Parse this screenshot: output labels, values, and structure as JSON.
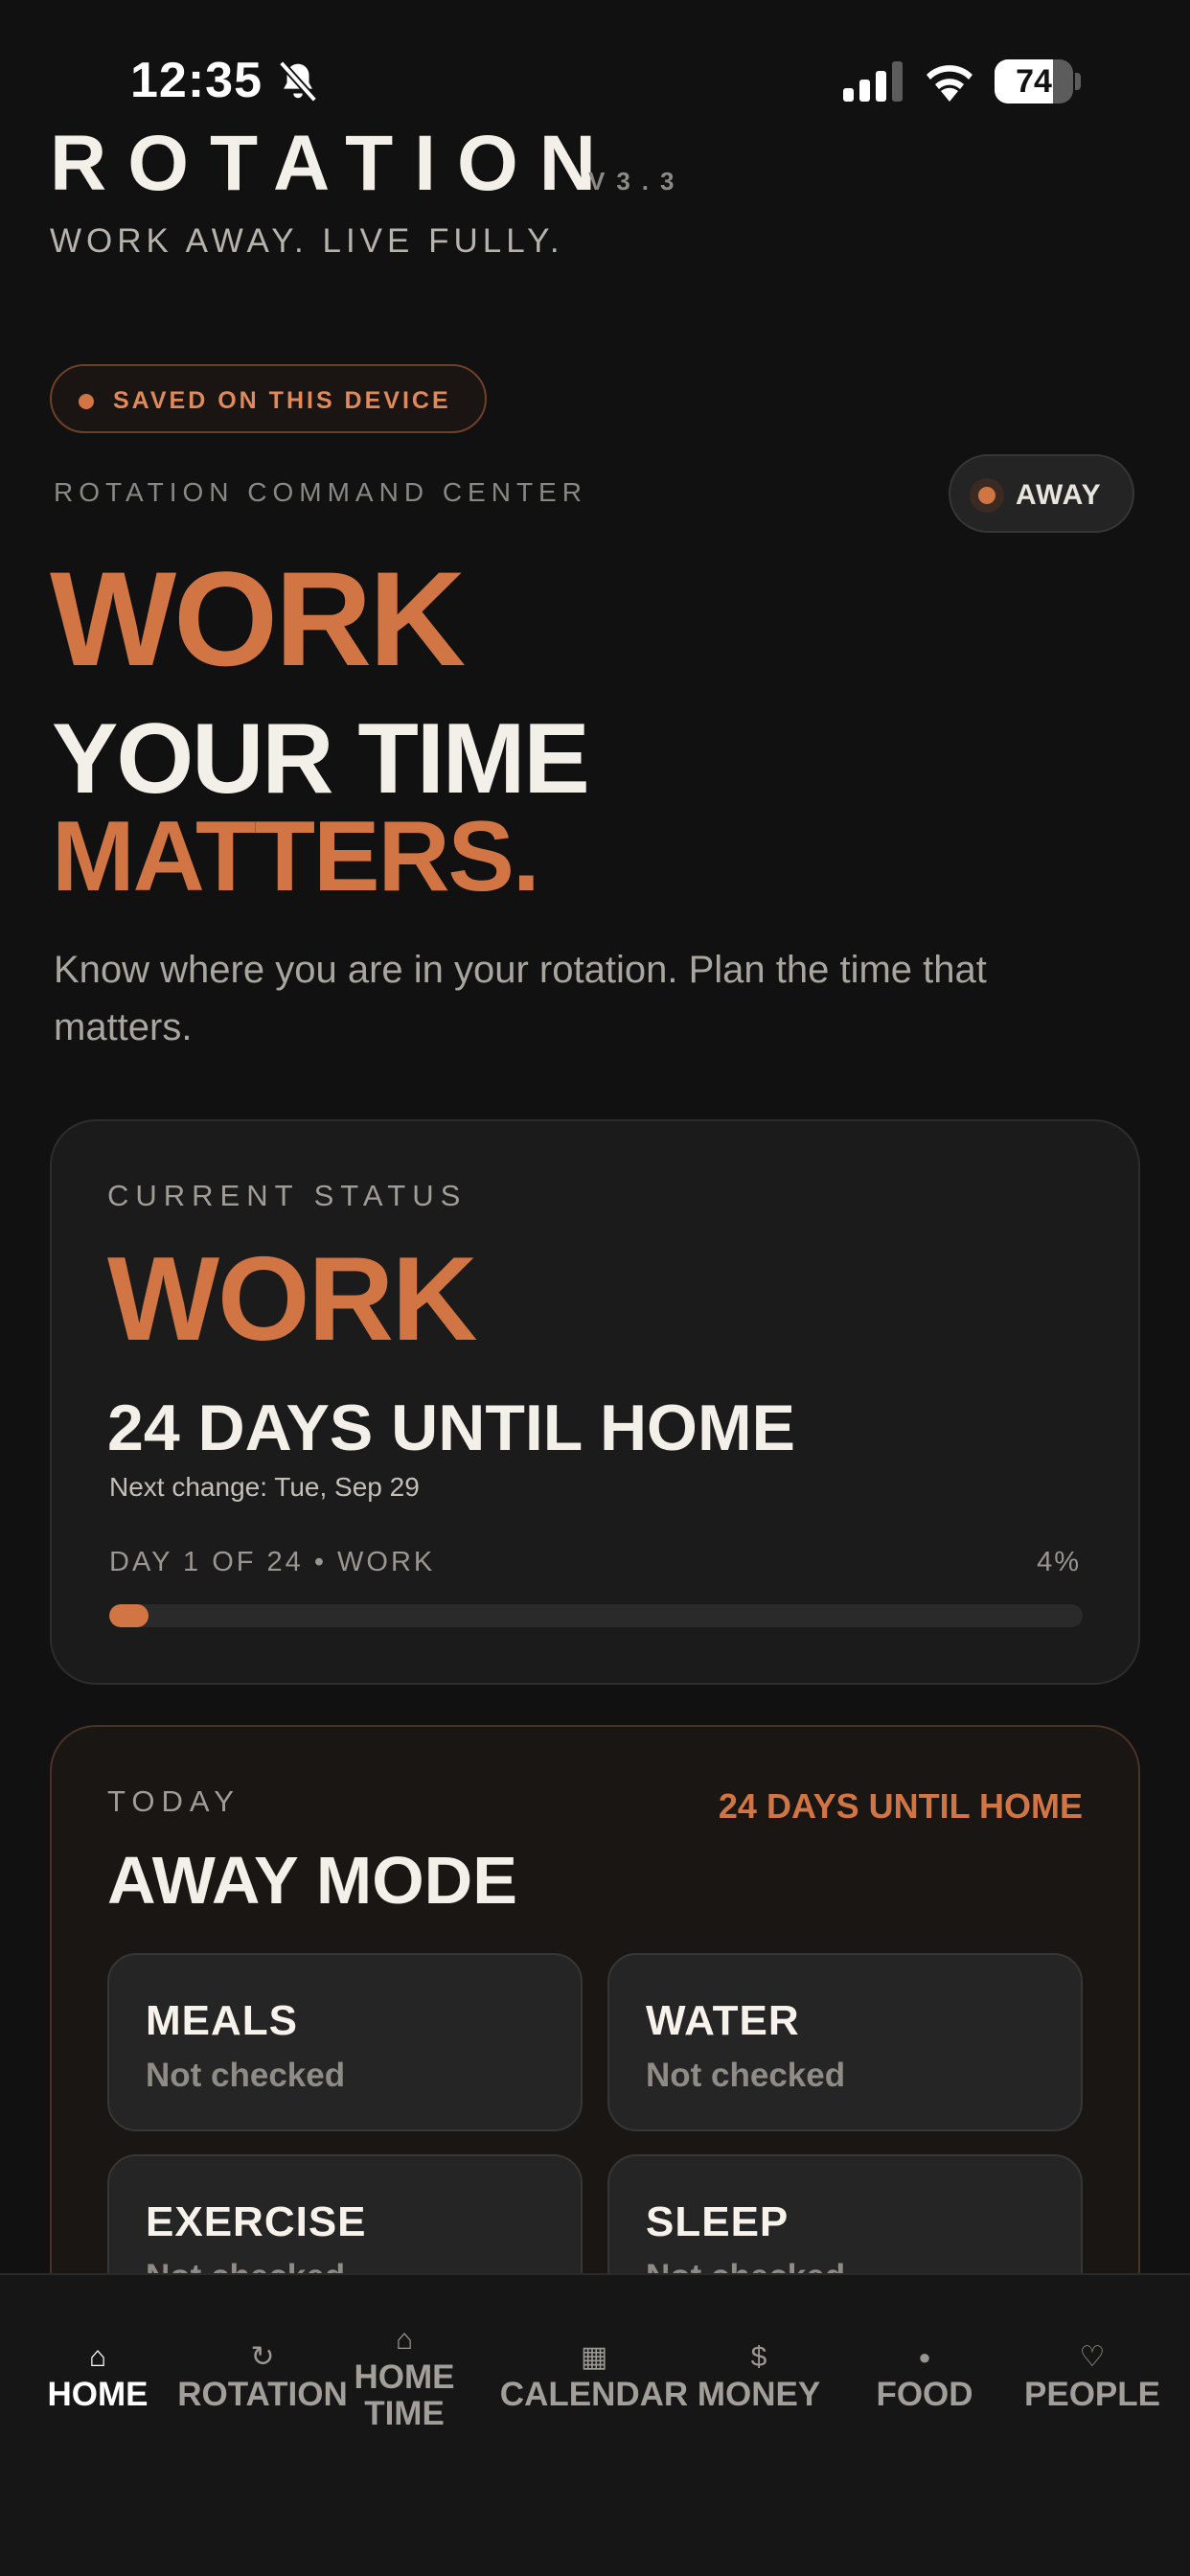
{
  "status_bar": {
    "time": "12:35",
    "silent_icon": "bell-slash-icon",
    "signal_icon": "cellular-signal-icon",
    "wifi_icon": "wifi-icon",
    "battery_level": "74",
    "battery_fraction": 0.74
  },
  "header": {
    "brand": "ROTATION",
    "version": "V3.3",
    "tagline": "WORK AWAY. LIVE FULLY."
  },
  "saved_badge": {
    "label": "SAVED ON THIS DEVICE",
    "dot_color": "#d27544"
  },
  "command_center": {
    "label": "ROTATION COMMAND CENTER",
    "mode_pill": "AWAY"
  },
  "hero": {
    "status": "WORK",
    "line2": "YOUR TIME",
    "line3": "MATTERS.",
    "description": "Know where you are in your rotation. Plan the time that matters."
  },
  "status_card": {
    "label": "CURRENT STATUS",
    "status": "WORK",
    "days_until": "24 DAYS UNTIL HOME",
    "next_change": "Next change: Tue, Sep 29",
    "day_progress": "DAY 1 OF 24 • WORK",
    "percent_label": "4%",
    "progress_fraction": 0.04
  },
  "today_card": {
    "label": "TODAY",
    "countdown": "24 DAYS UNTIL HOME",
    "title": "AWAY MODE",
    "tiles": [
      {
        "title": "MEALS",
        "status": "Not checked"
      },
      {
        "title": "WATER",
        "status": "Not checked"
      },
      {
        "title": "EXERCISE",
        "status": "Not checked"
      },
      {
        "title": "SLEEP",
        "status": "Not checked"
      }
    ]
  },
  "bottom_nav": {
    "items": [
      {
        "label": "HOME",
        "glyph": "⌂",
        "icon": "home-icon",
        "active": true
      },
      {
        "label": "ROTATION",
        "glyph": "↻",
        "icon": "rotation-icon",
        "active": false
      },
      {
        "label": "HOME\nTIME",
        "glyph": "⌂",
        "icon": "home-time-icon",
        "active": false
      },
      {
        "label": "CALENDAR",
        "glyph": "▦",
        "icon": "calendar-icon",
        "active": false
      },
      {
        "label": "MONEY",
        "glyph": "$",
        "icon": "money-icon",
        "active": false
      },
      {
        "label": "FOOD",
        "glyph": "●",
        "icon": "food-icon",
        "active": false
      },
      {
        "label": "PEOPLE",
        "glyph": "♡",
        "icon": "people-icon",
        "active": false
      }
    ]
  },
  "colors": {
    "background": "#111111",
    "accent": "#d27544",
    "text": "#f3efe9",
    "muted": "#8a8884"
  }
}
